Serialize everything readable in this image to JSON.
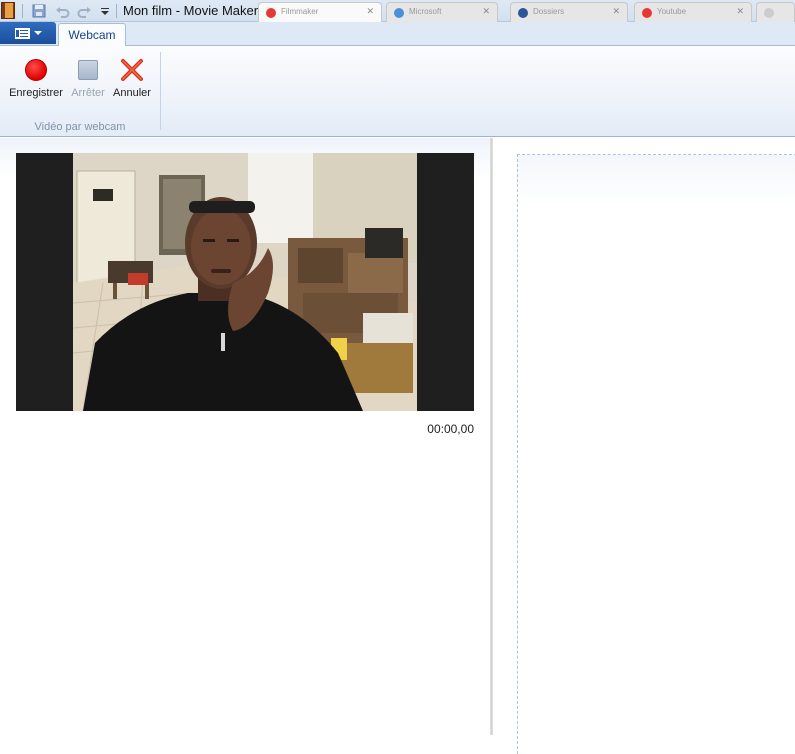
{
  "titlebar": {
    "title": "Mon film - Movie Maker",
    "qat_icons": [
      "save-icon",
      "undo-icon",
      "redo-icon",
      "customize-qat-icon"
    ]
  },
  "browser_tabs": [
    {
      "label": "Filmmaker",
      "color": "#e53935"
    },
    {
      "label": "Microsoft",
      "color": "#4a90d9"
    },
    {
      "label": "Dossiers",
      "color": "#2b5797"
    },
    {
      "label": "Youtube",
      "color": "#e53935"
    }
  ],
  "ribbon": {
    "app_menu_icon": "app-menu-icon",
    "tabs": [
      {
        "label": "Webcam",
        "selected": true
      }
    ],
    "group_label": "Vidéo par webcam",
    "commands": {
      "record": {
        "label": "Enregistrer",
        "icon": "record-icon",
        "enabled": true,
        "color": "#e10000"
      },
      "stop": {
        "label": "Arrêter",
        "icon": "stop-icon",
        "enabled": false
      },
      "cancel": {
        "label": "Annuler",
        "icon": "cancel-icon",
        "enabled": true,
        "color": "#d9341c"
      }
    }
  },
  "preview": {
    "timecode": "00:00,00"
  }
}
